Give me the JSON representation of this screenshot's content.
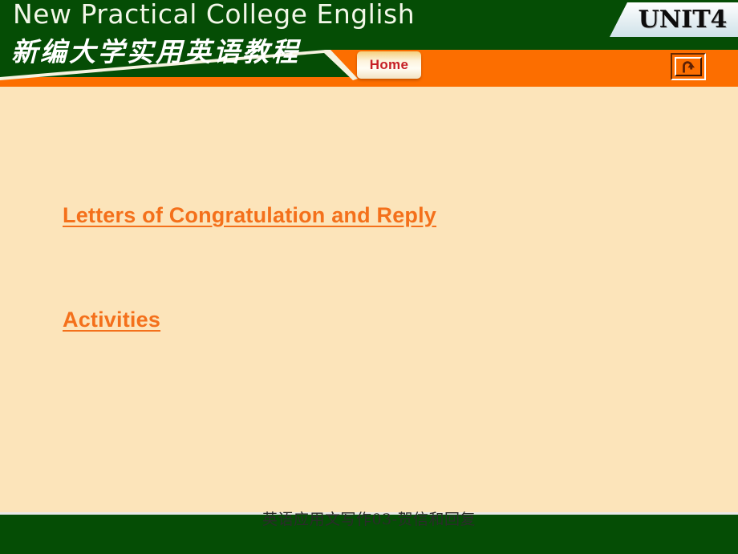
{
  "header": {
    "title_en": "New Practical College English",
    "title_cn": "新编大学实用英语教程",
    "unit_badge": "UNIT4",
    "home_label": "Home",
    "return_icon_name": "u-turn-arrow-icon",
    "colors": {
      "green": "#054D05",
      "orange": "#FC6E00",
      "badge": "#DFEDF2",
      "home_text": "#C62026"
    }
  },
  "content": {
    "links": [
      {
        "label": "Letters of Congratulation and Reply"
      },
      {
        "label": "Activities"
      }
    ],
    "colors": {
      "background": "#FCE4BA",
      "link": "#F4701B"
    }
  },
  "footer": {
    "text": "英语应用文写作03-贺信和回复",
    "colors": {
      "bar": "#054D05",
      "text": "#2B2B2B"
    }
  }
}
